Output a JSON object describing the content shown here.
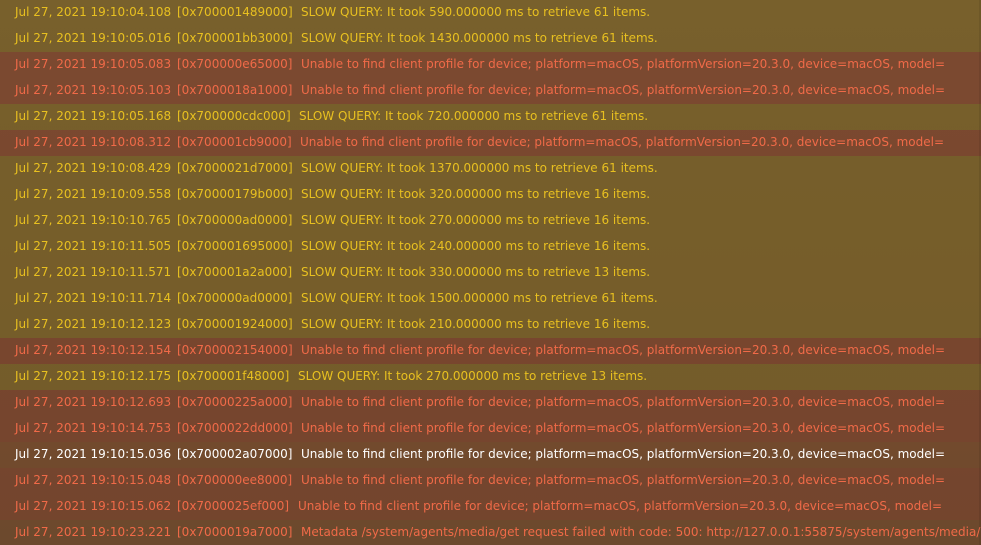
{
  "log": {
    "rows": [
      {
        "kind": "slow",
        "time": "Jul 27, 2021 19:10:04.108",
        "thread": "[0x700001489000]",
        "message": "SLOW QUERY: It took 590.000000 ms to retrieve 61 items."
      },
      {
        "kind": "slow",
        "time": "Jul 27, 2021 19:10:05.016",
        "thread": "[0x700001bb3000]",
        "message": "SLOW QUERY: It took 1430.000000 ms to retrieve 61 items."
      },
      {
        "kind": "err",
        "time": "Jul 27, 2021 19:10:05.083",
        "thread": "[0x700000e65000]",
        "message": "Unable to find client profile for device; platform=macOS, platformVersion=20.3.0, device=macOS, model="
      },
      {
        "kind": "err",
        "time": "Jul 27, 2021 19:10:05.103",
        "thread": "[0x7000018a1000]",
        "message": "Unable to find client profile for device; platform=macOS, platformVersion=20.3.0, device=macOS, model="
      },
      {
        "kind": "slow",
        "time": "Jul 27, 2021 19:10:05.168",
        "thread": "[0x700000cdc000]",
        "message": "SLOW QUERY: It took 720.000000 ms to retrieve 61 items."
      },
      {
        "kind": "err",
        "time": "Jul 27, 2021 19:10:08.312",
        "thread": "[0x700001cb9000]",
        "message": "Unable to find client profile for device; platform=macOS, platformVersion=20.3.0, device=macOS, model="
      },
      {
        "kind": "slow",
        "time": "Jul 27, 2021 19:10:08.429",
        "thread": "[0x7000021d7000]",
        "message": "SLOW QUERY: It took 1370.000000 ms to retrieve 61 items."
      },
      {
        "kind": "slow",
        "time": "Jul 27, 2021 19:10:09.558",
        "thread": "[0x70000179b000]",
        "message": "SLOW QUERY: It took 320.000000 ms to retrieve 16 items."
      },
      {
        "kind": "slow",
        "time": "Jul 27, 2021 19:10:10.765",
        "thread": "[0x700000ad0000]",
        "message": "SLOW QUERY: It took 270.000000 ms to retrieve 16 items."
      },
      {
        "kind": "slow",
        "time": "Jul 27, 2021 19:10:11.505",
        "thread": "[0x700001695000]",
        "message": "SLOW QUERY: It took 240.000000 ms to retrieve 16 items."
      },
      {
        "kind": "slow",
        "time": "Jul 27, 2021 19:10:11.571",
        "thread": "[0x700001a2a000]",
        "message": "SLOW QUERY: It took 330.000000 ms to retrieve 13 items."
      },
      {
        "kind": "slow",
        "time": "Jul 27, 2021 19:10:11.714",
        "thread": "[0x700000ad0000]",
        "message": "SLOW QUERY: It took 1500.000000 ms to retrieve 61 items."
      },
      {
        "kind": "slow",
        "time": "Jul 27, 2021 19:10:12.123",
        "thread": "[0x700001924000]",
        "message": "SLOW QUERY: It took 210.000000 ms to retrieve 16 items."
      },
      {
        "kind": "err",
        "time": "Jul 27, 2021 19:10:12.154",
        "thread": "[0x700002154000]",
        "message": "Unable to find client profile for device; platform=macOS, platformVersion=20.3.0, device=macOS, model="
      },
      {
        "kind": "slow",
        "time": "Jul 27, 2021 19:10:12.175",
        "thread": "[0x700001f48000]",
        "message": "SLOW QUERY: It took 270.000000 ms to retrieve 13 items."
      },
      {
        "kind": "err",
        "time": "Jul 27, 2021 19:10:12.693",
        "thread": "[0x70000225a000]",
        "message": "Unable to find client profile for device; platform=macOS, platformVersion=20.3.0, device=macOS, model="
      },
      {
        "kind": "err",
        "time": "Jul 27, 2021 19:10:14.753",
        "thread": "[0x7000022dd000]",
        "message": "Unable to find client profile for device; platform=macOS, platformVersion=20.3.0, device=macOS, model="
      },
      {
        "kind": "sel",
        "time": "Jul 27, 2021 19:10:15.036",
        "thread": "[0x700002a07000]",
        "message": "Unable to find client profile for device; platform=macOS, platformVersion=20.3.0, device=macOS, model="
      },
      {
        "kind": "err",
        "time": "Jul 27, 2021 19:10:15.048",
        "thread": "[0x700000ee8000]",
        "message": "Unable to find client profile for device; platform=macOS, platformVersion=20.3.0, device=macOS, model="
      },
      {
        "kind": "err",
        "time": "Jul 27, 2021 19:10:15.062",
        "thread": "[0x7000025ef000]",
        "message": "Unable to find client profile for device; platform=macOS, platformVersion=20.3.0, device=macOS, model="
      },
      {
        "kind": "meta",
        "time": "Jul 27, 2021 19:10:23.221",
        "thread": "[0x7000019a7000]",
        "message": "Metadata /system/agents/media/get request failed with code: 500: http://127.0.0.1:55875/system/agents/media/"
      }
    ]
  },
  "colors": {
    "slow_text": "#e8c020",
    "error_text": "#f06a48",
    "selected_text": "#ffffff",
    "background": "#744c2f"
  }
}
